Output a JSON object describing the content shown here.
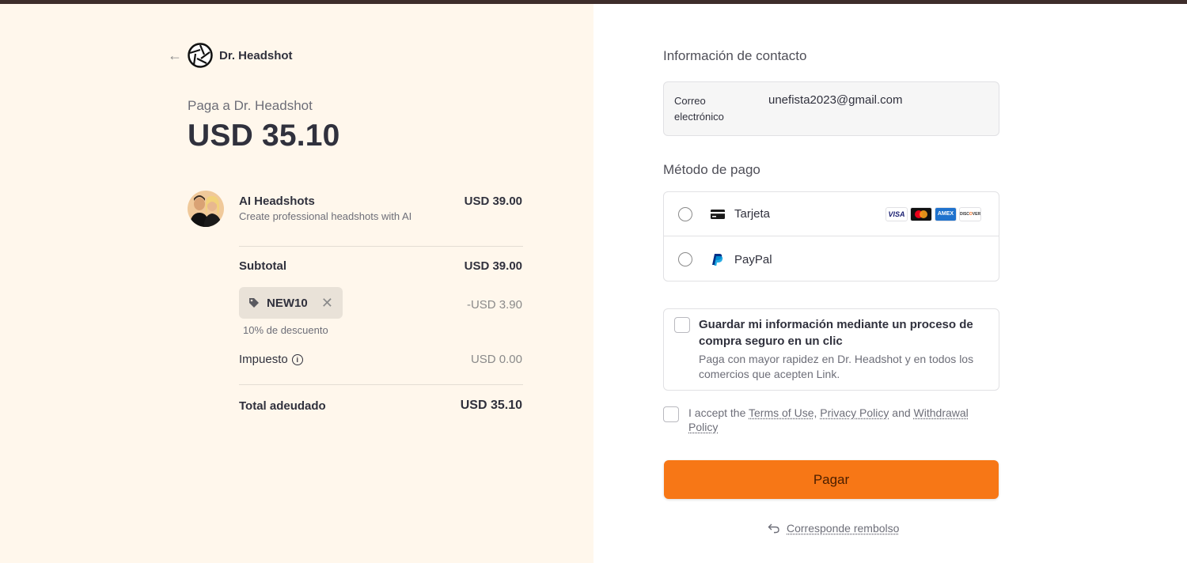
{
  "merchant": {
    "name": "Dr. Headshot",
    "pay_to": "Paga a Dr. Headshot",
    "amount": "USD 35.10"
  },
  "item": {
    "name": "AI Headshots",
    "description": "Create professional headshots with AI",
    "price": "USD 39.00"
  },
  "summary": {
    "subtotal_label": "Subtotal",
    "subtotal_value": "USD 39.00",
    "promo_code": "NEW10",
    "promo_amount": "-USD 3.90",
    "promo_desc": "10% de descuento",
    "tax_label": "Impuesto",
    "tax_value": "USD 0.00",
    "total_label": "Total adeudado",
    "total_value": "USD 35.10"
  },
  "contact": {
    "title": "Información de contacto",
    "email_label": "Correo electrónico",
    "email_value": "unefista2023@gmail.com"
  },
  "payment": {
    "title": "Método de pago",
    "methods": [
      {
        "label": "Tarjeta",
        "icon": "card-icon"
      },
      {
        "label": "PayPal",
        "icon": "paypal-icon"
      }
    ],
    "card_brands": [
      "VISA",
      "Mastercard",
      "AMEX",
      "DISCOVER"
    ]
  },
  "save_info": {
    "title": "Guardar mi información mediante un proceso de compra seguro en un clic",
    "description": "Paga con mayor rapidez en Dr. Headshot y en todos los comercios que acepten Link."
  },
  "terms": {
    "prefix": "I accept the ",
    "terms_link": "Terms of Use",
    "sep1": ", ",
    "privacy_link": "Privacy Policy",
    "sep2": " and ",
    "withdrawal_link": "Withdrawal Policy"
  },
  "pay_button": "Pagar",
  "refund_link": "Corresponde rembolso",
  "colors": {
    "left_bg": "#fff7ec",
    "accent": "#f77716",
    "topbar": "#3e2d2b"
  }
}
